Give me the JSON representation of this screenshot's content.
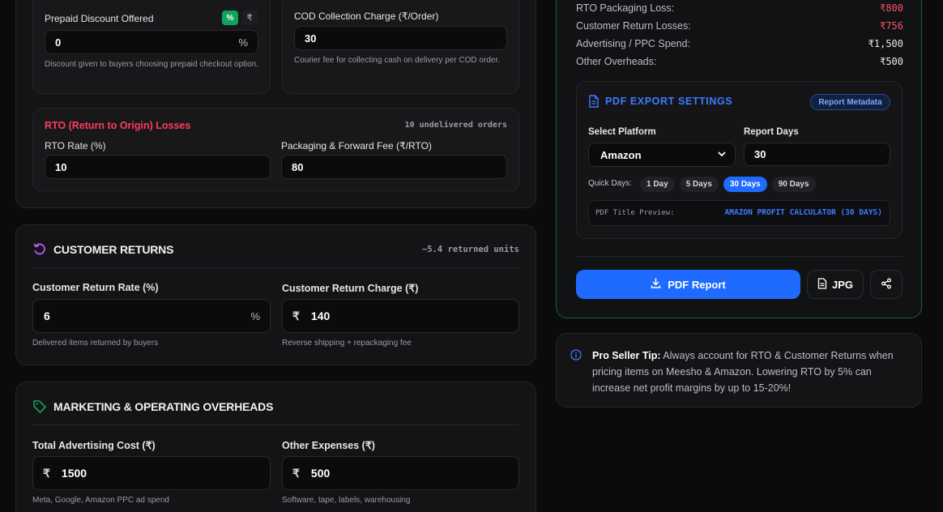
{
  "prepaid": {
    "label": "Prepaid Discount Offered",
    "toggle_percent": "%",
    "toggle_rupee": "₹",
    "value": "0",
    "suffix": "%",
    "help": "Discount given to buyers choosing prepaid checkout option."
  },
  "cod": {
    "label": "COD Collection Charge (₹/Order)",
    "value": "30",
    "help": "Courier fee for collecting cash on delivery per COD order."
  },
  "rto": {
    "title": "RTO (Return to Origin) Losses",
    "note": "10 undelivered orders",
    "rate_label": "RTO Rate (%)",
    "rate_value": "10",
    "fee_label": "Packaging & Forward Fee (₹/RTO)",
    "fee_value": "80"
  },
  "returns": {
    "title": "CUSTOMER RETURNS",
    "note": "~5.4 returned units",
    "rate_label": "Customer Return Rate (%)",
    "rate_value": "6",
    "rate_suffix": "%",
    "rate_help": "Delivered items returned by buyers",
    "charge_label": "Customer Return Charge (₹)",
    "charge_prefix": "₹",
    "charge_value": "140",
    "charge_help": "Reverse shipping + repackaging fee"
  },
  "marketing": {
    "title": "MARKETING & OPERATING OVERHEADS",
    "ads_label": "Total Advertising Cost (₹)",
    "ads_prefix": "₹",
    "ads_value": "1500",
    "ads_help": "Meta, Google, Amazon PPC ad spend",
    "other_label": "Other Expenses (₹)",
    "other_prefix": "₹",
    "other_value": "500",
    "other_help": "Software, tape, labels, warehousing"
  },
  "losses": [
    {
      "label": "RTO Packaging Loss:",
      "value": "₹800",
      "color": "#ff4d6a"
    },
    {
      "label": "Customer Return Losses:",
      "value": "₹756",
      "color": "#ff4d6a"
    },
    {
      "label": "Advertising / PPC Spend:",
      "value": "₹1,500",
      "color": "#e8e8ea"
    },
    {
      "label": "Other Overheads:",
      "value": "₹500",
      "color": "#e8e8ea"
    }
  ],
  "pdf": {
    "title": "PDF EXPORT SETTINGS",
    "metadata_badge": "Report Metadata",
    "platform_label": "Select Platform",
    "platform_value": "Amazon",
    "days_label": "Report Days",
    "days_value": "30",
    "quick_label": "Quick Days:",
    "quick_days": [
      "1 Day",
      "5 Days",
      "30 Days",
      "90 Days"
    ],
    "quick_active": "30 Days",
    "preview_label": "PDF Title Preview:",
    "preview_value": "AMAZON PROFIT CALCULATOR (30 DAYS)"
  },
  "actions": {
    "pdf_report": "PDF Report",
    "jpg": "JPG"
  },
  "tip": {
    "title": "Pro Seller Tip:",
    "body": " Always account for RTO & Customer Returns when pricing items on Meesho & Amazon. Lowering RTO by 5% can increase net profit margins by up to 15-20%!"
  },
  "colors": {
    "accent_blue": "#1f6bff",
    "danger": "#ff4d6a",
    "success": "#10a35a",
    "purple": "#b25cff"
  }
}
